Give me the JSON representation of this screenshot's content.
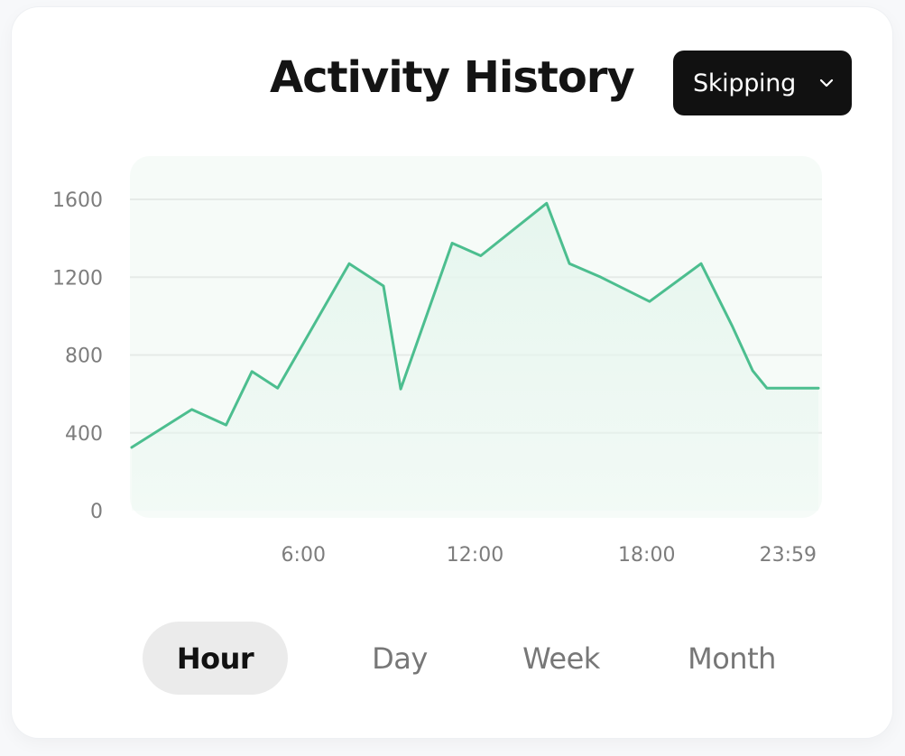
{
  "header": {
    "title": "Activity History",
    "dropdown_value": "Skipping",
    "dropdown_icon": "chevron-down-icon"
  },
  "tabs": [
    {
      "label": "Hour",
      "active": true
    },
    {
      "label": "Day",
      "active": false
    },
    {
      "label": "Week",
      "active": false
    },
    {
      "label": "Month",
      "active": false
    }
  ],
  "colors": {
    "line": "#4cbe8f",
    "area": "#e6f6ee",
    "plot_background": "#f6fbf8",
    "grid": "#e6ebe8"
  },
  "chart_data": {
    "type": "area",
    "title": "",
    "xlabel": "",
    "ylabel": "",
    "x_range": [
      "0:00",
      "23:59"
    ],
    "ylim": [
      0,
      1600
    ],
    "y_ticks": [
      "0",
      "400",
      "800",
      "1200",
      "1600"
    ],
    "x_ticks": [
      "6:00",
      "12:00",
      "18:00",
      "23:59"
    ],
    "x_tick_positions_hours": [
      6,
      12,
      18,
      23.98
    ],
    "grid": true,
    "series": [
      {
        "x_hours": [
          0,
          2.1,
          3.3,
          4.2,
          5.1,
          7.6,
          8.8,
          9.4,
          11.2,
          12.2,
          14.5,
          15.3,
          16.4,
          18.1,
          19.9,
          21.0,
          21.7,
          22.2,
          22.5,
          23.5,
          24.0
        ],
        "values": [
          325,
          520,
          440,
          715,
          630,
          1270,
          1155,
          625,
          1375,
          1310,
          1580,
          1270,
          1200,
          1075,
          1270,
          945,
          720,
          630,
          630,
          630,
          630
        ]
      }
    ]
  }
}
